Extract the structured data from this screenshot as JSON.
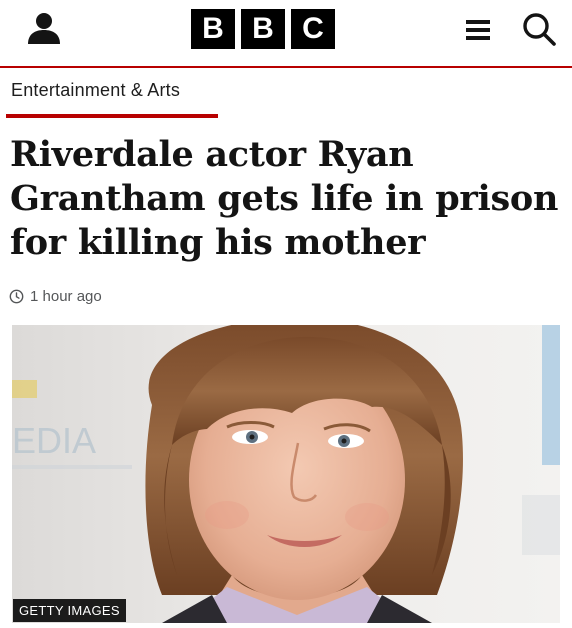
{
  "header": {
    "logo_letters": [
      "B",
      "B",
      "C"
    ],
    "account_icon": "account-icon",
    "menu_icon": "menu-icon",
    "search_icon": "search-icon",
    "accent_color": "#b80000"
  },
  "section": {
    "label": "Entertainment & Arts"
  },
  "article": {
    "headline": "Riverdale actor Ryan Grantham gets life in prison for killing his mother",
    "timestamp": "1 hour ago"
  },
  "photo": {
    "credit": "GETTY IMAGES",
    "backdrop_text": "EDIA"
  }
}
